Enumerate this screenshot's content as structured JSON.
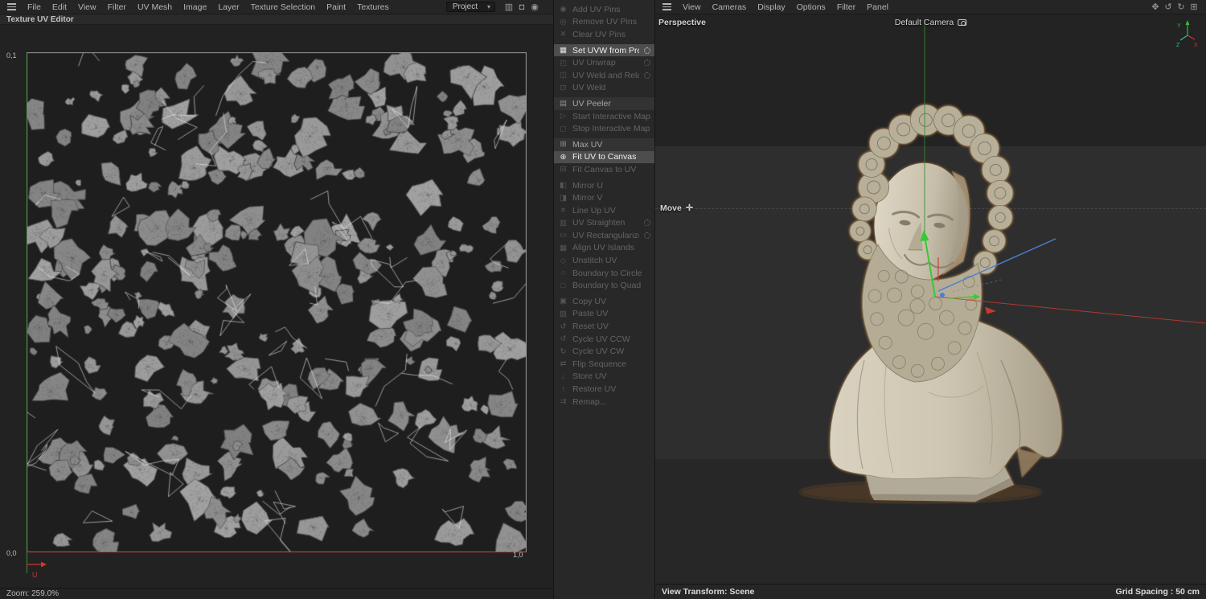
{
  "left_menubar": {
    "menus": [
      "File",
      "Edit",
      "View",
      "Filter",
      "UV Mesh",
      "Image",
      "Layer",
      "Texture Selection",
      "Paint",
      "Textures"
    ],
    "project_dropdown": {
      "label": "Project",
      "caret": "▾"
    },
    "icons": [
      {
        "name": "histogram-icon",
        "glyph": "▥"
      },
      {
        "name": "lock-icon",
        "glyph": "◘"
      },
      {
        "name": "pin-icon",
        "glyph": "◉"
      }
    ]
  },
  "uv_editor": {
    "title": "Texture UV Editor",
    "corner_top_left": "0,1",
    "corner_bottom_left": "0,0",
    "corner_bottom_right": "1,0",
    "axis_u_label": "U",
    "zoom_status": "Zoom: 259.0%"
  },
  "uv_commands": {
    "separators_after": [
      2,
      6,
      9,
      12,
      21
    ],
    "items": [
      {
        "label": "Add UV Pins",
        "icon": "◉",
        "state": "disabled"
      },
      {
        "label": "Remove UV Pins",
        "icon": "◎",
        "state": "disabled"
      },
      {
        "label": "Clear UV Pins",
        "icon": "✕",
        "state": "disabled"
      },
      {
        "label": "Set UVW from Projection",
        "icon": "▦",
        "state": "selected",
        "gear": true
      },
      {
        "label": "UV Unwrap",
        "icon": "◰",
        "state": "disabled",
        "gear": true
      },
      {
        "label": "UV Weld and Relax",
        "icon": "◫",
        "state": "disabled",
        "gear": true
      },
      {
        "label": "UV Weld",
        "icon": "⊡",
        "state": "disabled"
      },
      {
        "label": "UV Peeler",
        "icon": "▤",
        "state": "enabled"
      },
      {
        "label": "Start Interactive Mapping",
        "icon": "▷",
        "state": "disabled"
      },
      {
        "label": "Stop Interactive Mapping",
        "icon": "◻",
        "state": "disabled"
      },
      {
        "label": "Max UV",
        "icon": "⊞",
        "state": "enabled"
      },
      {
        "label": "Fit UV to Canvas",
        "icon": "⊕",
        "state": "selected"
      },
      {
        "label": "Fit Canvas to UV",
        "icon": "⊟",
        "state": "disabled"
      },
      {
        "label": "Mirror U",
        "icon": "◧",
        "state": "disabled"
      },
      {
        "label": "Mirror V",
        "icon": "◨",
        "state": "disabled"
      },
      {
        "label": "Line Up UV",
        "icon": "≡",
        "state": "disabled"
      },
      {
        "label": "UV Straighten",
        "icon": "▥",
        "state": "disabled",
        "gear": true
      },
      {
        "label": "UV Rectangularize",
        "icon": "▭",
        "state": "disabled",
        "gear": true
      },
      {
        "label": "Align UV Islands",
        "icon": "▦",
        "state": "disabled"
      },
      {
        "label": "Unstitch UV",
        "icon": "◇",
        "state": "disabled"
      },
      {
        "label": "Boundary to Circle",
        "icon": "○",
        "state": "disabled"
      },
      {
        "label": "Boundary to Quad",
        "icon": "□",
        "state": "disabled"
      },
      {
        "label": "Copy UV",
        "icon": "▣",
        "state": "disabled"
      },
      {
        "label": "Paste UV",
        "icon": "▨",
        "state": "disabled"
      },
      {
        "label": "Reset UV",
        "icon": "↺",
        "state": "disabled"
      },
      {
        "label": "Cycle UV CCW",
        "icon": "↺",
        "state": "disabled"
      },
      {
        "label": "Cycle UV CW",
        "icon": "↻",
        "state": "disabled"
      },
      {
        "label": "Flip Sequence",
        "icon": "⇄",
        "state": "disabled"
      },
      {
        "label": "Store UV",
        "icon": "↓",
        "state": "disabled"
      },
      {
        "label": "Restore UV",
        "icon": "↑",
        "state": "disabled"
      },
      {
        "label": "Remap...",
        "icon": "⇉",
        "state": "disabled"
      }
    ]
  },
  "viewport": {
    "menubar": {
      "menus": [
        "View",
        "Cameras",
        "Display",
        "Options",
        "Filter",
        "Panel"
      ],
      "icons": [
        {
          "name": "pan-hand-icon",
          "glyph": "✥"
        },
        {
          "name": "undo-icon",
          "glyph": "↺"
        },
        {
          "name": "redo-icon",
          "glyph": "↻"
        },
        {
          "name": "layout-icon",
          "glyph": "⊞"
        }
      ]
    },
    "view_label": "Perspective",
    "camera_label": "Default Camera",
    "tool_label": "Move",
    "tool_icon_glyph": "✛",
    "axis_widget": {
      "x": "X",
      "y": "Y",
      "z": "Z"
    },
    "status_left": "View Transform: Scene",
    "status_right": "Grid Spacing : 50 cm"
  },
  "colors": {
    "accent_green": "#35c935",
    "accent_red": "#c83a2e",
    "accent_blue": "#4a7fd4",
    "selection_orange": "#c97a33"
  }
}
